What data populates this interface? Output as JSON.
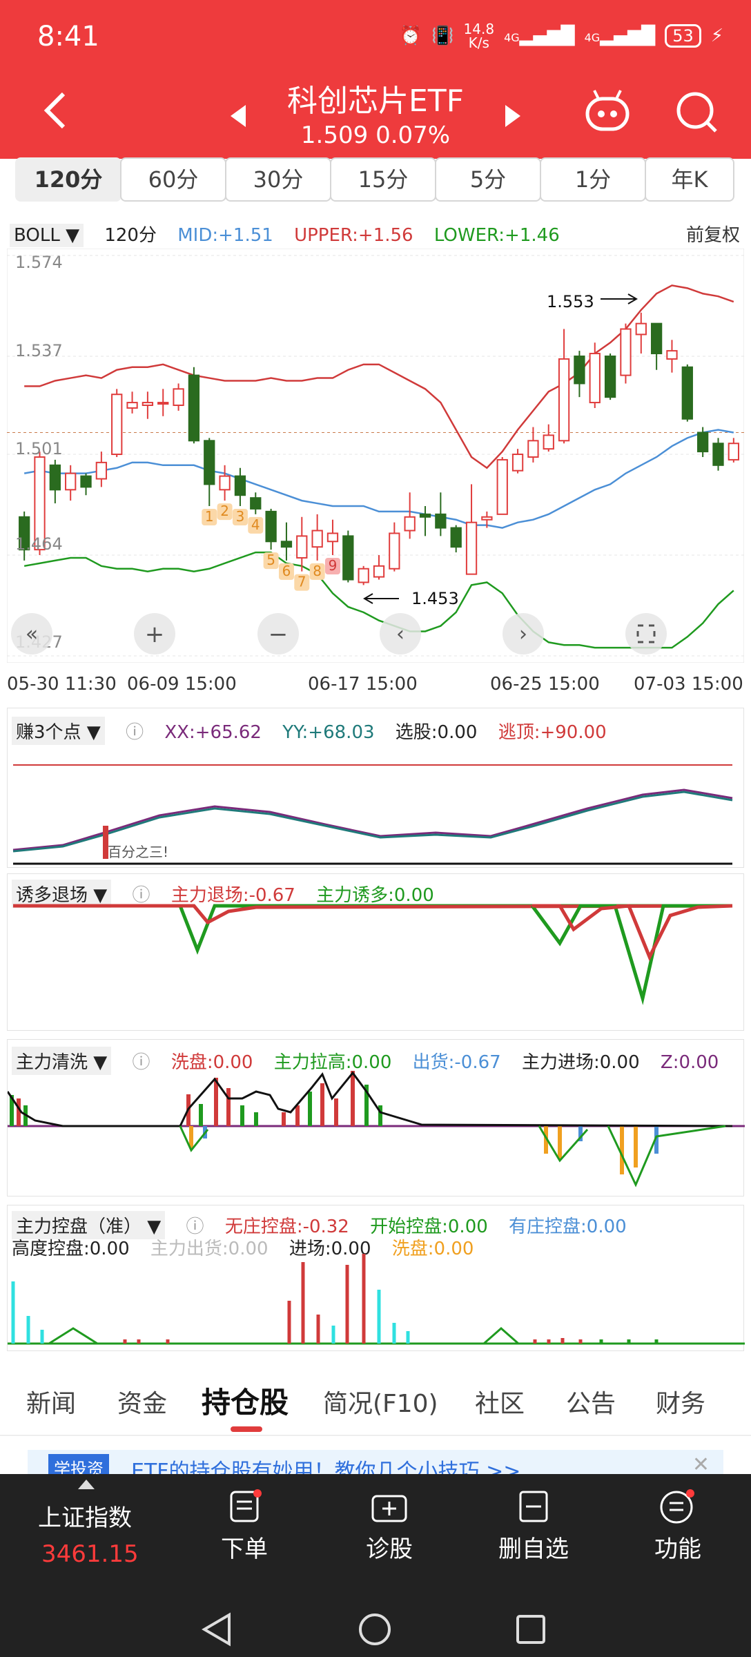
{
  "status_bar": {
    "time": "8:41",
    "net_speed_value": "14.8",
    "net_speed_unit": "K/s",
    "signal1": "4G",
    "signal2": "4G",
    "battery": "53"
  },
  "header": {
    "title": "科创芯片ETF",
    "price_change": "1.509 0.07%"
  },
  "period_tabs": [
    "120分",
    "60分",
    "30分",
    "15分",
    "5分",
    "1分",
    "年K"
  ],
  "boll": {
    "selector": "BOLL ▼",
    "period": "120分",
    "mid": "MID:+1.51",
    "upper": "UPPER:+1.56",
    "lower": "LOWER:+1.46",
    "adjust": "前复权"
  },
  "price_axis": [
    "1.574",
    "1.537",
    "1.501",
    "1.464",
    "1.427"
  ],
  "date_axis": [
    "05-30 11:30",
    "06-09 15:00",
    "06-17 15:00",
    "06-25 15:00",
    "07-03 15:00"
  ],
  "annotations": {
    "high": "1.553",
    "low": "1.453",
    "seq": [
      "1",
      "2",
      "3",
      "4",
      "5",
      "6",
      "7",
      "8",
      "9"
    ]
  },
  "colors": {
    "up": "#e03c3c",
    "down": "#2a6b1f",
    "upper": "#d03a3a",
    "mid": "#4b8fd6",
    "lower": "#1f9a1f",
    "header": "#ee3b3d"
  },
  "chart_data": {
    "type": "candlestick",
    "ylim": [
      1.427,
      1.574
    ],
    "candles": [
      {
        "o": 1.478,
        "c": 1.466,
        "h": 1.48,
        "l": 1.462
      },
      {
        "o": 1.466,
        "c": 1.5,
        "h": 1.502,
        "l": 1.464
      },
      {
        "o": 1.497,
        "c": 1.488,
        "h": 1.499,
        "l": 1.483
      },
      {
        "o": 1.488,
        "c": 1.494,
        "h": 1.497,
        "l": 1.484
      },
      {
        "o": 1.493,
        "c": 1.489,
        "h": 1.494,
        "l": 1.486
      },
      {
        "o": 1.492,
        "c": 1.498,
        "h": 1.502,
        "l": 1.489
      },
      {
        "o": 1.501,
        "c": 1.523,
        "h": 1.525,
        "l": 1.5
      },
      {
        "o": 1.518,
        "c": 1.52,
        "h": 1.524,
        "l": 1.516
      },
      {
        "o": 1.519,
        "c": 1.52,
        "h": 1.524,
        "l": 1.514
      },
      {
        "o": 1.52,
        "c": 1.52,
        "h": 1.525,
        "l": 1.515
      },
      {
        "o": 1.519,
        "c": 1.525,
        "h": 1.527,
        "l": 1.517
      },
      {
        "o": 1.53,
        "c": 1.506,
        "h": 1.533,
        "l": 1.505
      },
      {
        "o": 1.506,
        "c": 1.49,
        "h": 1.507,
        "l": 1.482
      },
      {
        "o": 1.488,
        "c": 1.493,
        "h": 1.497,
        "l": 1.484
      },
      {
        "o": 1.493,
        "c": 1.486,
        "h": 1.496,
        "l": 1.482
      },
      {
        "o": 1.485,
        "c": 1.481,
        "h": 1.487,
        "l": 1.479
      },
      {
        "o": 1.48,
        "c": 1.469,
        "h": 1.481,
        "l": 1.466
      },
      {
        "o": 1.469,
        "c": 1.467,
        "h": 1.476,
        "l": 1.462
      },
      {
        "o": 1.463,
        "c": 1.471,
        "h": 1.478,
        "l": 1.458
      },
      {
        "o": 1.467,
        "c": 1.473,
        "h": 1.479,
        "l": 1.462
      },
      {
        "o": 1.469,
        "c": 1.472,
        "h": 1.477,
        "l": 1.464
      },
      {
        "o": 1.471,
        "c": 1.455,
        "h": 1.473,
        "l": 1.454
      },
      {
        "o": 1.454,
        "c": 1.459,
        "h": 1.46,
        "l": 1.453
      },
      {
        "o": 1.456,
        "c": 1.46,
        "h": 1.464,
        "l": 1.455
      },
      {
        "o": 1.459,
        "c": 1.472,
        "h": 1.476,
        "l": 1.458
      },
      {
        "o": 1.473,
        "c": 1.478,
        "h": 1.487,
        "l": 1.47
      },
      {
        "o": 1.479,
        "c": 1.478,
        "h": 1.482,
        "l": 1.471
      },
      {
        "o": 1.479,
        "c": 1.474,
        "h": 1.487,
        "l": 1.471
      },
      {
        "o": 1.474,
        "c": 1.467,
        "h": 1.475,
        "l": 1.465
      },
      {
        "o": 1.457,
        "c": 1.476,
        "h": 1.49,
        "l": 1.457
      },
      {
        "o": 1.477,
        "c": 1.478,
        "h": 1.48,
        "l": 1.474
      },
      {
        "o": 1.479,
        "c": 1.499,
        "h": 1.5,
        "l": 1.479
      },
      {
        "o": 1.495,
        "c": 1.501,
        "h": 1.503,
        "l": 1.494
      },
      {
        "o": 1.5,
        "c": 1.506,
        "h": 1.511,
        "l": 1.498
      },
      {
        "o": 1.503,
        "c": 1.508,
        "h": 1.512,
        "l": 1.502
      },
      {
        "o": 1.506,
        "c": 1.536,
        "h": 1.547,
        "l": 1.505
      },
      {
        "o": 1.537,
        "c": 1.527,
        "h": 1.539,
        "l": 1.522
      },
      {
        "o": 1.52,
        "c": 1.538,
        "h": 1.542,
        "l": 1.518
      },
      {
        "o": 1.537,
        "c": 1.522,
        "h": 1.538,
        "l": 1.521
      },
      {
        "o": 1.53,
        "c": 1.547,
        "h": 1.549,
        "l": 1.527
      },
      {
        "o": 1.545,
        "c": 1.549,
        "h": 1.553,
        "l": 1.538
      },
      {
        "o": 1.549,
        "c": 1.538,
        "h": 1.549,
        "l": 1.532
      },
      {
        "o": 1.536,
        "c": 1.539,
        "h": 1.543,
        "l": 1.531
      },
      {
        "o": 1.533,
        "c": 1.514,
        "h": 1.534,
        "l": 1.513
      },
      {
        "o": 1.509,
        "c": 1.502,
        "h": 1.511,
        "l": 1.5
      },
      {
        "o": 1.505,
        "c": 1.497,
        "h": 1.507,
        "l": 1.495
      },
      {
        "o": 1.499,
        "c": 1.505,
        "h": 1.507,
        "l": 1.498
      }
    ],
    "upper": [
      1.526,
      1.526,
      1.528,
      1.529,
      1.53,
      1.529,
      1.532,
      1.533,
      1.533,
      1.534,
      1.532,
      1.53,
      1.529,
      1.528,
      1.528,
      1.528,
      1.529,
      1.528,
      1.528,
      1.529,
      1.529,
      1.532,
      1.534,
      1.534,
      1.531,
      1.528,
      1.525,
      1.52,
      1.51,
      1.5,
      1.496,
      1.502,
      1.51,
      1.517,
      1.524,
      1.527,
      1.531,
      1.538,
      1.542,
      1.547,
      1.554,
      1.56,
      1.563,
      1.562,
      1.56,
      1.559,
      1.557
    ],
    "mid": [
      1.494,
      1.495,
      1.494,
      1.494,
      1.494,
      1.495,
      1.496,
      1.498,
      1.498,
      1.497,
      1.497,
      1.497,
      1.495,
      1.494,
      1.492,
      1.49,
      1.488,
      1.486,
      1.484,
      1.483,
      1.482,
      1.482,
      1.482,
      1.48,
      1.48,
      1.48,
      1.479,
      1.478,
      1.477,
      1.475,
      1.475,
      1.474,
      1.476,
      1.477,
      1.479,
      1.482,
      1.485,
      1.488,
      1.49,
      1.494,
      1.497,
      1.5,
      1.504,
      1.507,
      1.509,
      1.51,
      1.509
    ],
    "lower": [
      1.46,
      1.461,
      1.462,
      1.463,
      1.463,
      1.46,
      1.459,
      1.459,
      1.458,
      1.459,
      1.459,
      1.458,
      1.459,
      1.461,
      1.463,
      1.465,
      1.465,
      1.461,
      1.46,
      1.457,
      1.45,
      1.445,
      1.443,
      1.44,
      1.438,
      1.436,
      1.436,
      1.438,
      1.443,
      1.453,
      1.454,
      1.45,
      1.442,
      1.436,
      1.432,
      1.431,
      1.431,
      1.43,
      1.43,
      1.43,
      1.43,
      1.43,
      1.43,
      1.434,
      1.439,
      1.446,
      1.451
    ]
  },
  "ind1": {
    "name": "赚3个点 ▼",
    "xx": "XX:+65.62",
    "yy": "YY:+68.03",
    "select": "选股:0.00",
    "escape": "逃顶:+90.00",
    "note": "百分之三!"
  },
  "ind2": {
    "name": "诱多退场 ▼",
    "exit": "主力退场:-0.67",
    "lure": "主力诱多:0.00"
  },
  "ind3": {
    "name": "主力清洗 ▼",
    "wash": "洗盘:0.00",
    "raise": "主力拉高:0.00",
    "ship": "出货:-0.67",
    "enter": "主力进场:0.00",
    "z": "Z:0.00"
  },
  "ind4": {
    "name": "主力控盘（准） ▼",
    "none": "无庄控盘:-0.32",
    "start": "开始控盘:0.00",
    "has": "有庄控盘:0.00",
    "high": "高度控盘:0.00",
    "out": "主力出货:0.00",
    "enter": "进场:0.00",
    "wash": "洗盘:0.00"
  },
  "bottom_tabs": [
    "新闻",
    "资金",
    "持仓股",
    "简况(F10)",
    "社区",
    "公告",
    "财务"
  ],
  "banner": {
    "tag": "学投资",
    "text": "ETF的持仓股有妙用！教你几个小技巧 >>"
  },
  "dock": {
    "index_name": "上证指数",
    "index_value": "3461.15",
    "order": "下单",
    "diagnose": "诊股",
    "remove": "删自选",
    "func": "功能"
  }
}
